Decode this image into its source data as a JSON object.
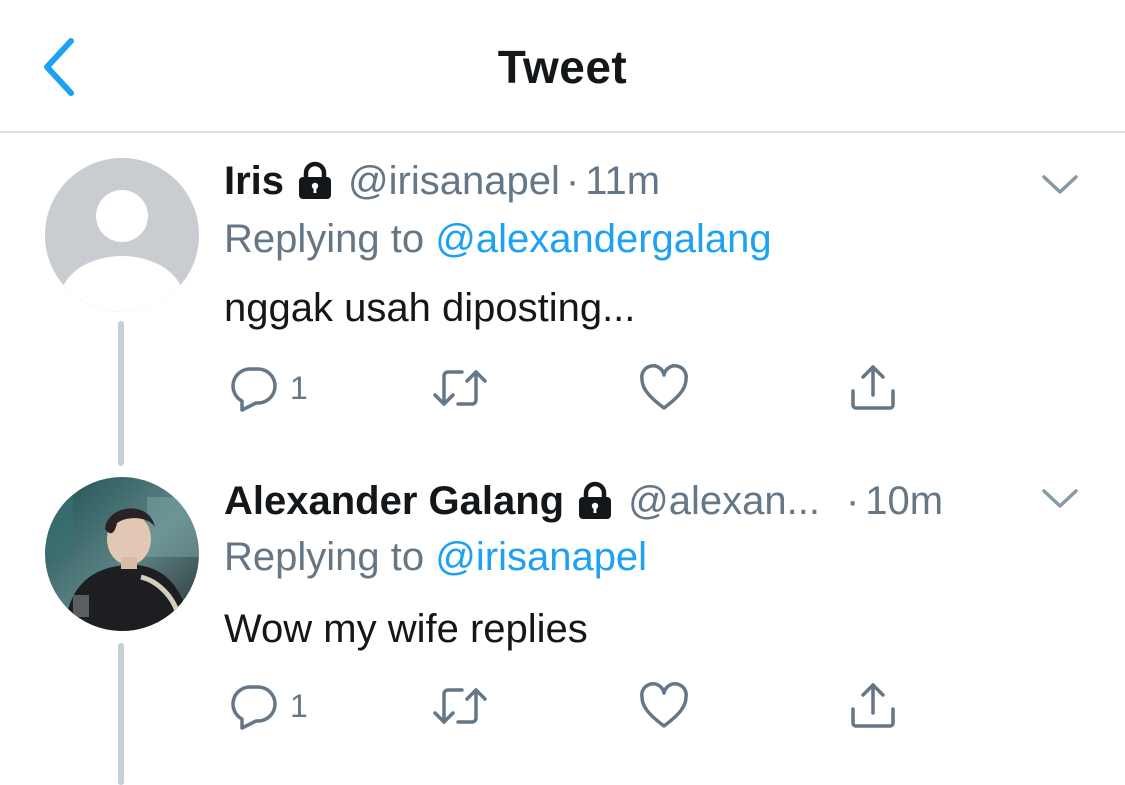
{
  "header": {
    "title": "Tweet"
  },
  "colors": {
    "accent": "#1da1f2",
    "muted": "#657786",
    "text": "#14171a",
    "divider": "#dbe0e4"
  },
  "tweets": [
    {
      "display_name": "Iris",
      "handle": "@irisanapel",
      "separator": "·",
      "time": "11m",
      "replying_prefix": "Replying to",
      "replying_to": "@alexandergalang",
      "text": "nggak usah diposting...",
      "reply_count": "1",
      "avatar": "default-avatar",
      "protected": true
    },
    {
      "display_name": "Alexander Galang",
      "handle": "@alexan...",
      "separator": "·",
      "time": "10m",
      "replying_prefix": "Replying to",
      "replying_to": "@irisanapel",
      "text": "Wow my wife replies",
      "reply_count": "1",
      "avatar": "photo-avatar",
      "protected": true
    }
  ],
  "icons": [
    "back-chevron-icon",
    "lock-icon",
    "chevron-down-icon",
    "reply-icon",
    "retweet-icon",
    "like-icon",
    "share-icon"
  ]
}
